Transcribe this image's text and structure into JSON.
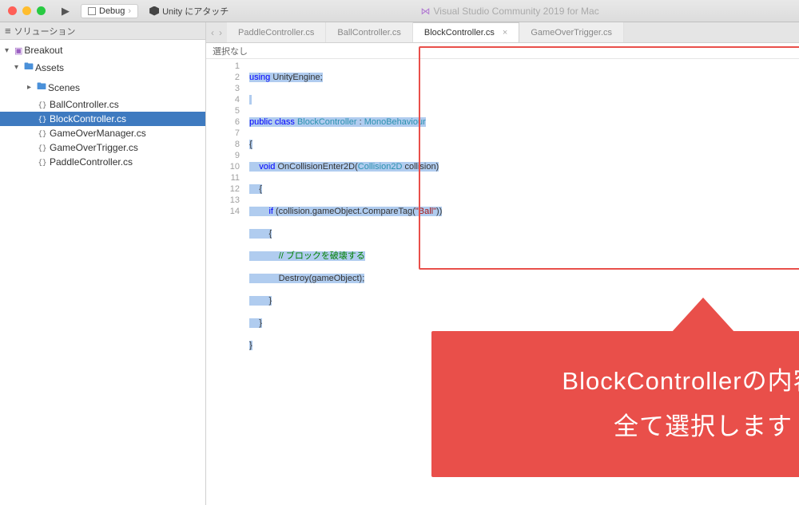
{
  "titlebar": {
    "debug_label": "Debug",
    "attach_label": "Unity にアタッチ",
    "title": "Visual Studio Community 2019 for Mac"
  },
  "sidebar": {
    "header": "ソリューション",
    "tree": {
      "root": "Breakout",
      "assets": "Assets",
      "scenes": "Scenes",
      "files": [
        "BallController.cs",
        "BlockController.cs",
        "GameOverManager.cs",
        "GameOverTrigger.cs",
        "PaddleController.cs"
      ]
    }
  },
  "tabs": {
    "items": [
      "PaddleController.cs",
      "BallController.cs",
      "BlockController.cs",
      "GameOverTrigger.cs"
    ],
    "active_index": 2
  },
  "breadcrumb": "選択なし",
  "code": {
    "lines": [
      "using UnityEngine;",
      "",
      "public class BlockController : MonoBehaviour",
      "{",
      "    void OnCollisionEnter2D(Collision2D collision)",
      "    {",
      "        if (collision.gameObject.CompareTag(\"Ball\"))",
      "        {",
      "            // ブロックを破壊する",
      "            Destroy(gameObject);",
      "        }",
      "    }",
      "}",
      ""
    ]
  },
  "callout": {
    "line1": "BlockControllerの内容を",
    "line2": "全て選択します"
  }
}
